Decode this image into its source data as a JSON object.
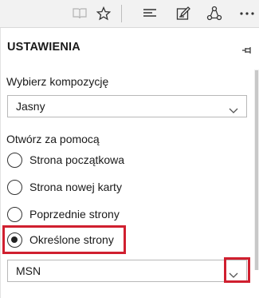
{
  "toolbar": {
    "icons": [
      "reading-view-icon",
      "favorite-star-icon",
      "hub-icon",
      "web-note-icon",
      "share-icon",
      "more-icon"
    ]
  },
  "panel": {
    "title": "USTAWIENIA",
    "theme_label": "Wybierz kompozycję",
    "theme_value": "Jasny",
    "open_with_label": "Otwórz za pomocą",
    "options": [
      {
        "label": "Strona początkowa",
        "checked": false
      },
      {
        "label": "Strona nowej karty",
        "checked": false
      },
      {
        "label": "Poprzednie strony",
        "checked": false
      },
      {
        "label": "Określone strony",
        "checked": true
      }
    ],
    "pages_value": "MSN"
  },
  "colors": {
    "highlight": "#d01f2f",
    "toolbar_bg": "#f2f2f2"
  }
}
